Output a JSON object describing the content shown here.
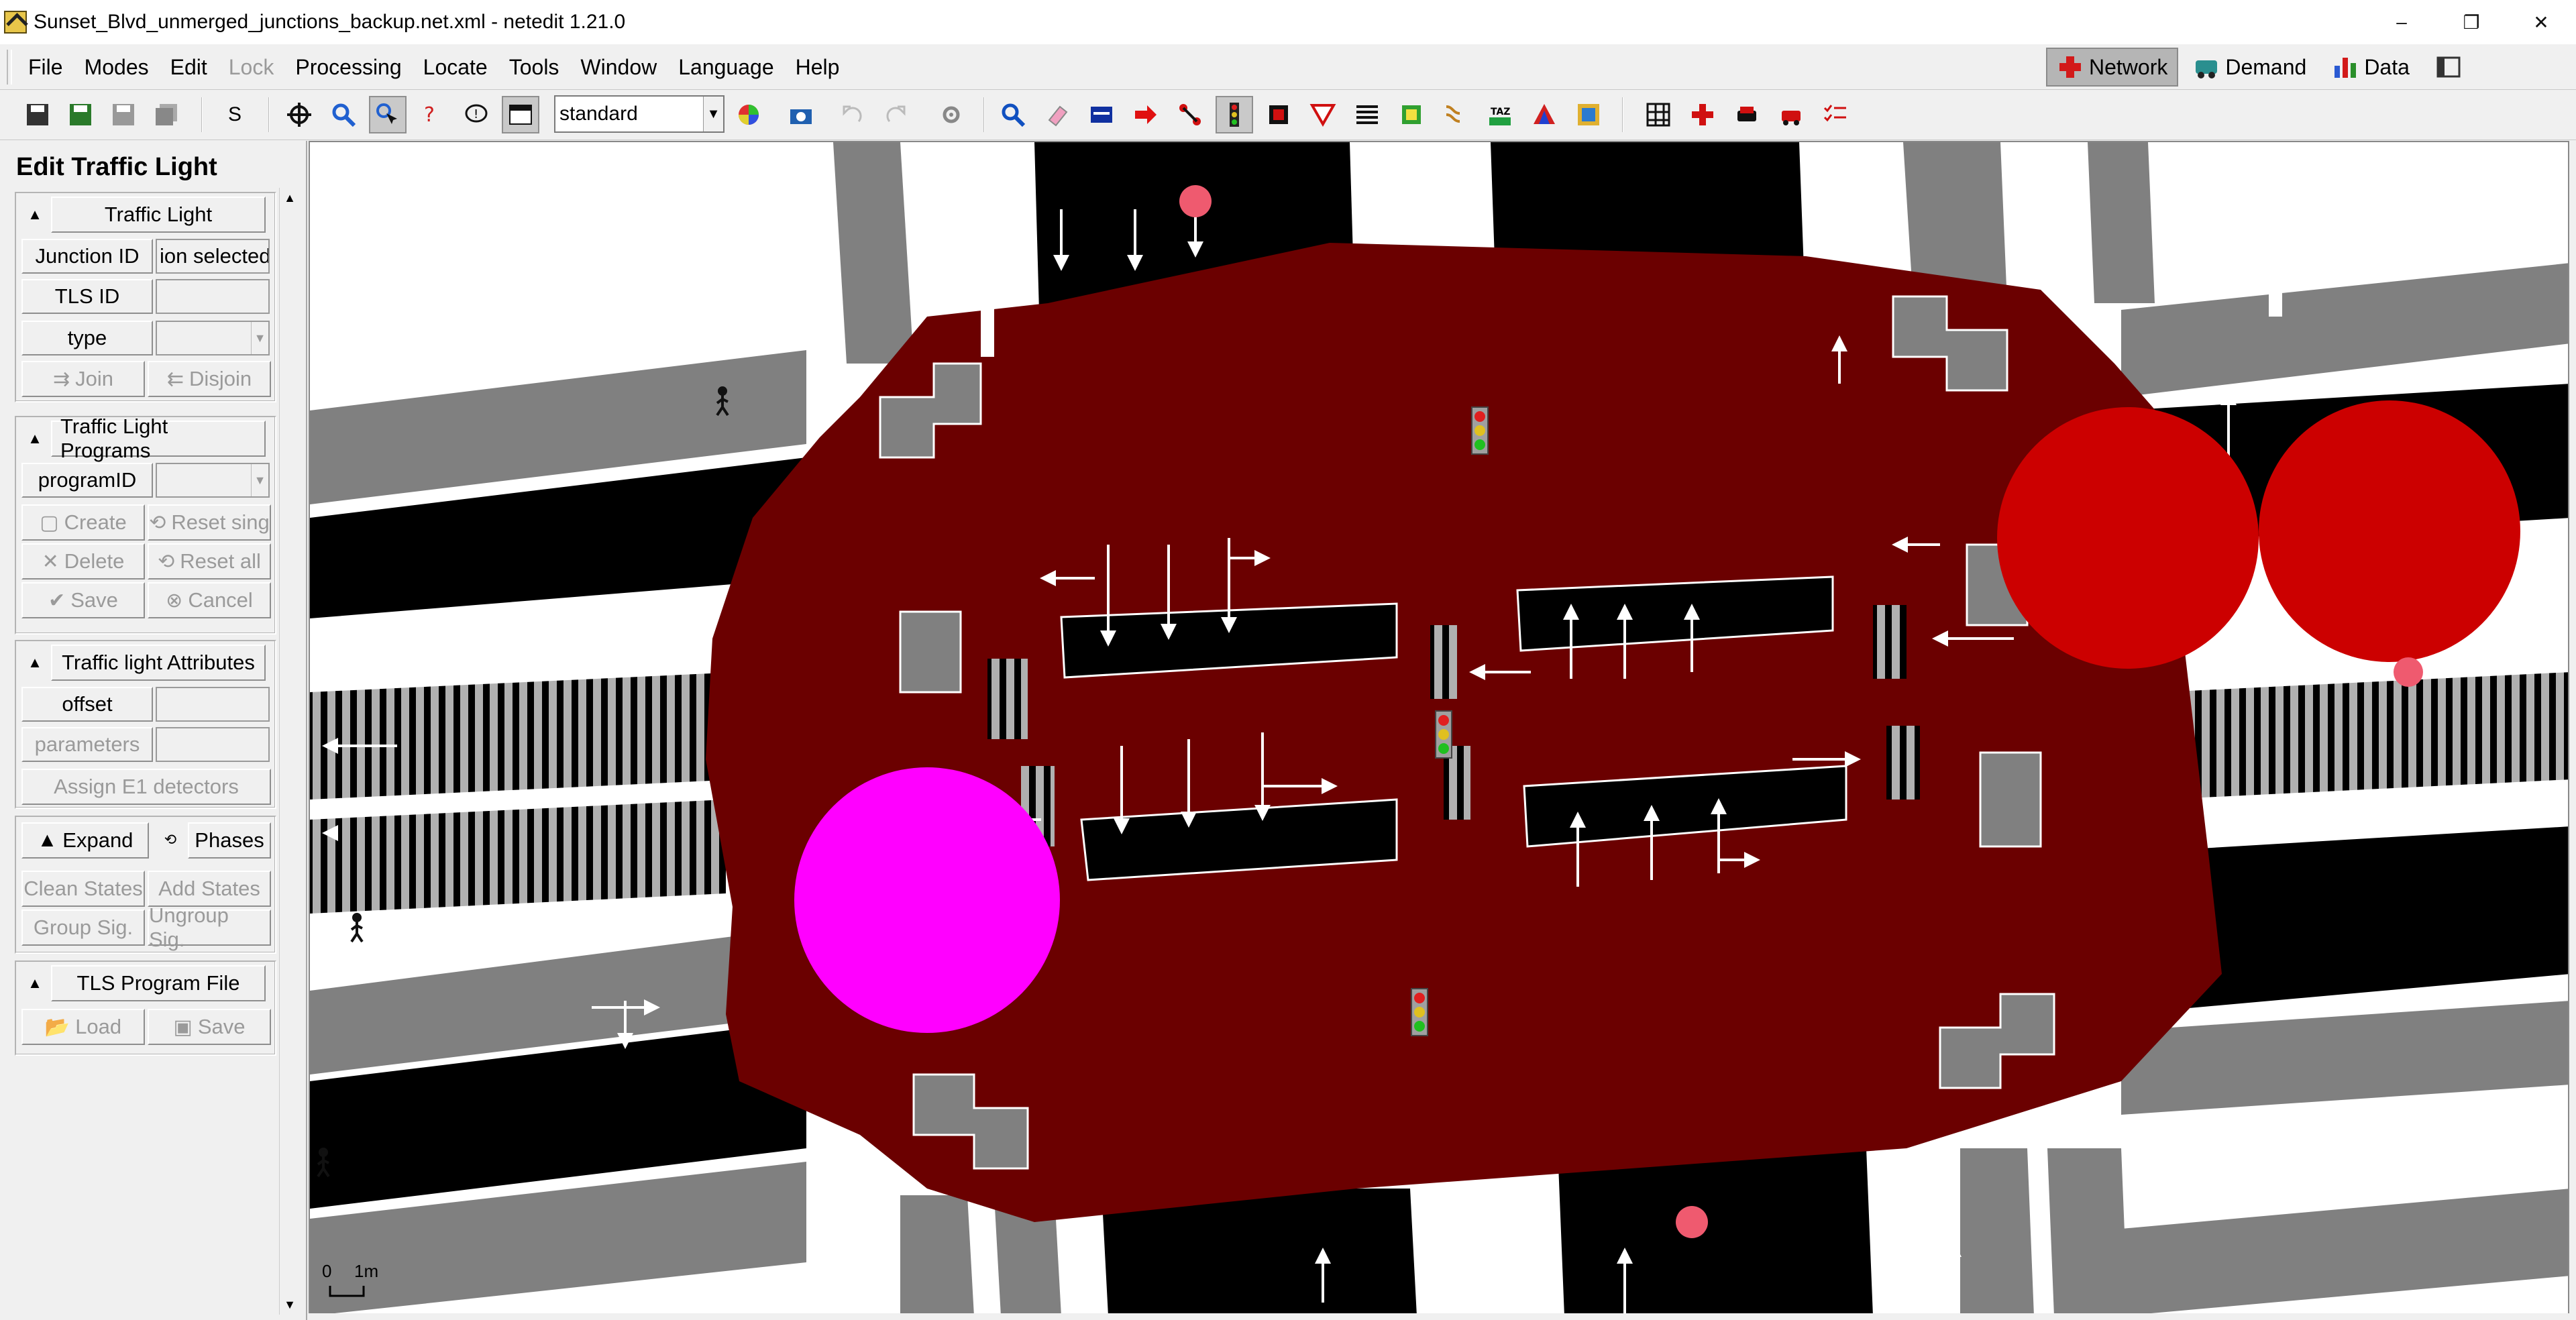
{
  "window": {
    "title": "Sunset_Blvd_unmerged_junctions_backup.net.xml - netedit 1.21.0",
    "minimize": "–",
    "restore": "❐",
    "close": "✕"
  },
  "menu": {
    "items": [
      "File",
      "Modes",
      "Edit",
      "Lock",
      "Processing",
      "Locate",
      "Tools",
      "Window",
      "Language",
      "Help"
    ],
    "disabled": [
      "Lock"
    ]
  },
  "supermodes": [
    {
      "label": "Network",
      "icon": "network-icon",
      "color": "#d21a1a",
      "active": true
    },
    {
      "label": "Demand",
      "icon": "demand-icon",
      "color": "#2a8f8f",
      "active": false
    },
    {
      "label": "Data",
      "icon": "data-icon",
      "color": "#2a5ad2",
      "active": false
    }
  ],
  "toolbar": {
    "s_label": "S",
    "scheme_value": "standard"
  },
  "panel": {
    "title": "Edit Traffic Light",
    "traffic_light": {
      "header": "Traffic Light",
      "junction_id_label": "Junction ID",
      "junction_id_value": "ion selected",
      "tls_id_label": "TLS ID",
      "tls_id_value": "",
      "type_label": "type",
      "type_value": "",
      "join_label": "Join",
      "disjoin_label": "Disjoin"
    },
    "programs": {
      "header": "Traffic Light Programs",
      "program_id_label": "programID",
      "program_id_value": "",
      "create_label": "Create",
      "reset_single_label": "Reset sing",
      "delete_label": "Delete",
      "reset_all_label": "Reset all",
      "save_label": "Save",
      "cancel_label": "Cancel"
    },
    "attributes": {
      "header": "Traffic light Attributes",
      "offset_label": "offset",
      "offset_value": "",
      "parameters_label": "parameters",
      "parameters_value": "",
      "assign_e1_label": "Assign E1 detectors"
    },
    "phases": {
      "expand_label": "Expand",
      "phases_label": "Phases",
      "clean_states_label": "Clean States",
      "add_states_label": "Add States",
      "group_sig_label": "Group Sig.",
      "ungroup_sig_label": "Ungroup Sig."
    },
    "program_file": {
      "header": "TLS Program File",
      "load_label": "Load",
      "save_label": "Save"
    }
  },
  "canvas": {
    "scale_zero": "0",
    "scale_unit": "1m",
    "colors": {
      "junction": "#6b0000",
      "lane": "#000000",
      "sidewalk": "#808080",
      "crossing_stripe": "#ffffff",
      "selected_junction": "#cc0000",
      "highlight_bubble": "#ff00ff",
      "rail": "#a0a0a0"
    }
  }
}
